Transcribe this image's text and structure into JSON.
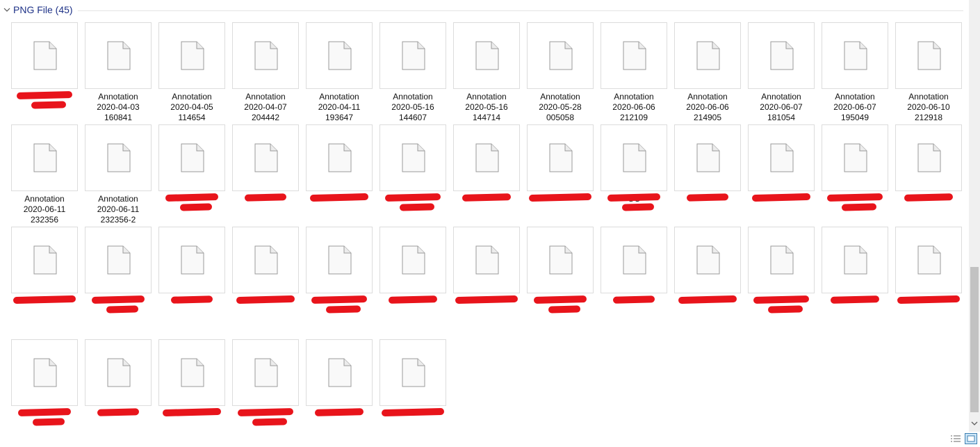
{
  "group": {
    "title": "PNG File (45)"
  },
  "files": [
    {
      "label": "",
      "redact": true
    },
    {
      "label": "Annotation\n2020-04-03\n160841"
    },
    {
      "label": "Annotation\n2020-04-05\n114654"
    },
    {
      "label": "Annotation\n2020-04-07\n204442"
    },
    {
      "label": "Annotation\n2020-04-11\n193647"
    },
    {
      "label": "Annotation\n2020-05-16\n144607"
    },
    {
      "label": "Annotation\n2020-05-16\n144714"
    },
    {
      "label": "Annotation\n2020-05-28\n005058"
    },
    {
      "label": "Annotation\n2020-06-06\n212109"
    },
    {
      "label": "Annotation\n2020-06-06\n214905"
    },
    {
      "label": "Annotation\n2020-06-07\n181054"
    },
    {
      "label": "Annotation\n2020-06-07\n195049"
    },
    {
      "label": "Annotation\n2020-06-10\n212918"
    },
    {
      "label": "Annotation\n2020-06-11\n232356"
    },
    {
      "label": "Annotation\n2020-06-11\n232356-2"
    },
    {
      "label": "",
      "redact": true
    },
    {
      "label": "",
      "redact": true
    },
    {
      "label": "",
      "redact": true
    },
    {
      "label": "",
      "redact": true
    },
    {
      "label": "",
      "redact": true
    },
    {
      "label": "",
      "redact": true
    },
    {
      "label": "GC",
      "redact": true
    },
    {
      "label": "",
      "redact": true
    },
    {
      "label": "",
      "redact": true
    },
    {
      "label": "",
      "redact": true
    },
    {
      "label": "",
      "redact": true
    },
    {
      "label": "",
      "redact": true
    },
    {
      "label": "",
      "redact": true
    },
    {
      "label": "",
      "redact": true
    },
    {
      "label": "",
      "redact": true
    },
    {
      "label": "",
      "redact": true
    },
    {
      "label": "",
      "redact": true
    },
    {
      "label": "",
      "redact": true
    },
    {
      "label": "",
      "redact": true
    },
    {
      "label": "",
      "redact": true
    },
    {
      "label": "",
      "redact": true
    },
    {
      "label": "",
      "redact": true
    },
    {
      "label": "",
      "redact": true
    },
    {
      "label": "",
      "redact": true
    },
    {
      "label": "",
      "redact": true
    },
    {
      "label": "",
      "redact": true
    },
    {
      "label": "",
      "redact": true
    },
    {
      "label": "",
      "redact": true
    },
    {
      "label": "",
      "redact": true
    },
    {
      "label": "",
      "redact": true
    }
  ],
  "icons": {
    "group_toggle": "chevron-down-icon",
    "file": "file-icon",
    "details_view": "details-view-icon",
    "large_icons_view": "large-icons-view-icon"
  },
  "colors": {
    "group_title": "#1e3287",
    "redaction": "#e8141b"
  }
}
